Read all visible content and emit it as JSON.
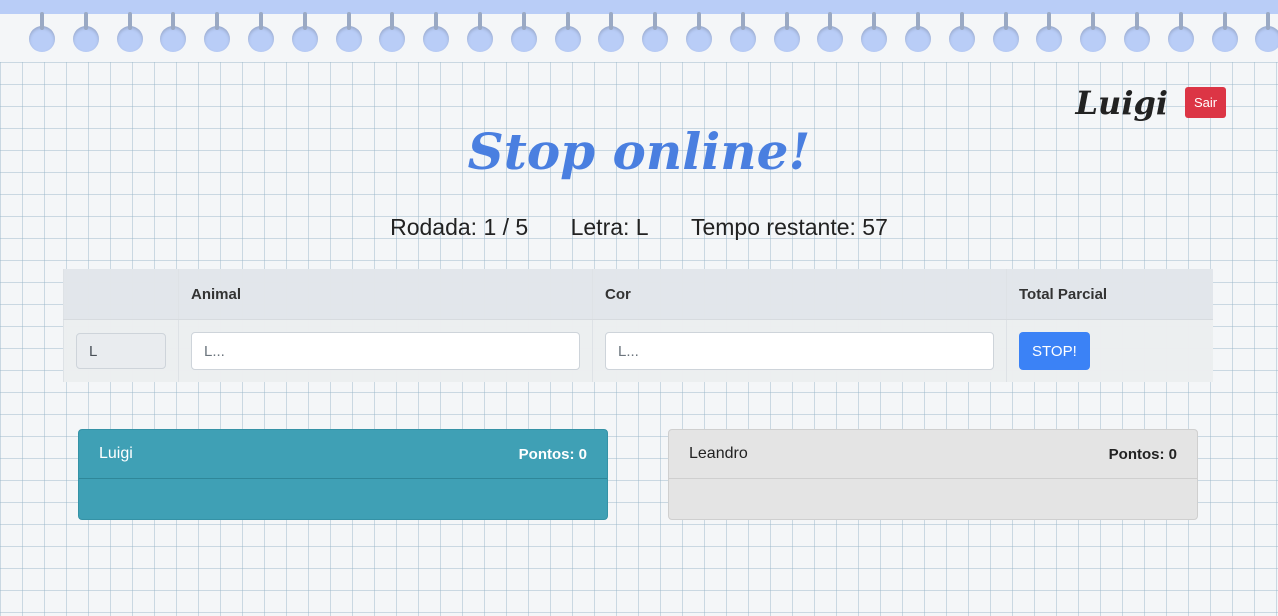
{
  "header": {
    "user_name": "Luigi",
    "logout_label": "Sair",
    "title": "Stop online!"
  },
  "status": {
    "round": "Rodada: 1 / 5",
    "letter": "Letra: L",
    "time_left": "Tempo restante: 57"
  },
  "table": {
    "columns": [
      "",
      "Animal",
      "Cor",
      "Total Parcial"
    ],
    "row": {
      "letter": "L",
      "animal_placeholder": "L...",
      "color_placeholder": "L...",
      "stop_label": "STOP!"
    }
  },
  "players": [
    {
      "name": "Luigi",
      "points": "Pontos: 0"
    },
    {
      "name": "Leandro",
      "points": "Pontos: 0"
    }
  ],
  "colors": {
    "accent_blue": "#4a7fe0",
    "danger": "#dc3545",
    "primary": "#3b82f6",
    "active_player": "#3fa0b5",
    "spiral": "#b9cdf7"
  }
}
